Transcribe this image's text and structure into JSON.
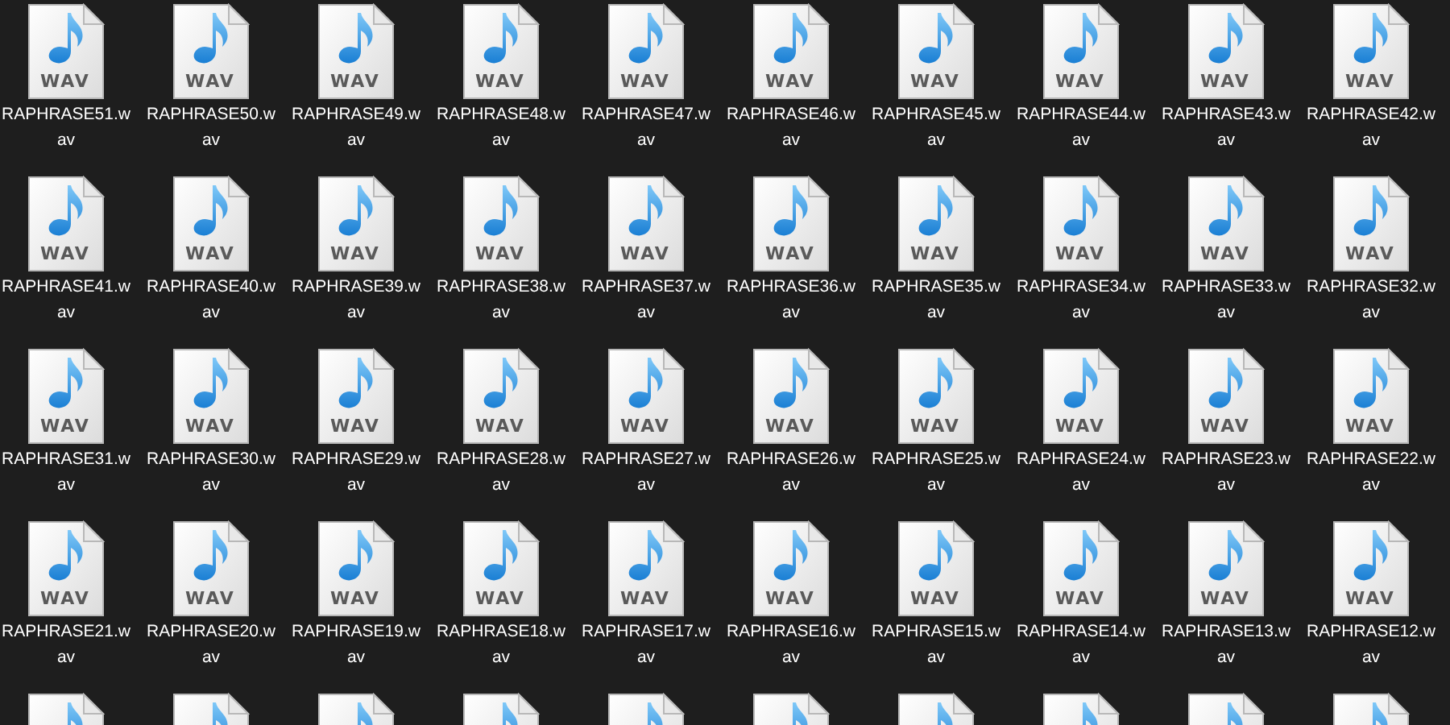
{
  "rows": [
    {
      "files": [
        {
          "kind": "full",
          "type": "WAV",
          "name": "RAPHRASE51.wav"
        },
        {
          "kind": "full",
          "type": "WAV",
          "name": "RAPHRASE50.wav"
        },
        {
          "kind": "full",
          "type": "WAV",
          "name": "RAPHRASE49.wav"
        },
        {
          "kind": "full",
          "type": "WAV",
          "name": "RAPHRASE48.wav"
        },
        {
          "kind": "full",
          "type": "WAV",
          "name": "RAPHRASE47.wav"
        },
        {
          "kind": "full",
          "type": "WAV",
          "name": "RAPHRASE46.wav"
        },
        {
          "kind": "full",
          "type": "WAV",
          "name": "RAPHRASE45.wav"
        },
        {
          "kind": "full",
          "type": "WAV",
          "name": "RAPHRASE44.wav"
        },
        {
          "kind": "full",
          "type": "WAV",
          "name": "RAPHRASE43.wav"
        },
        {
          "kind": "full",
          "type": "WAV",
          "name": "RAPHRASE42.wav"
        }
      ]
    },
    {
      "files": [
        {
          "kind": "full",
          "type": "WAV",
          "name": "RAPHRASE41.wav"
        },
        {
          "kind": "full",
          "type": "WAV",
          "name": "RAPHRASE40.wav"
        },
        {
          "kind": "full",
          "type": "WAV",
          "name": "RAPHRASE39.wav"
        },
        {
          "kind": "full",
          "type": "WAV",
          "name": "RAPHRASE38.wav"
        },
        {
          "kind": "full",
          "type": "WAV",
          "name": "RAPHRASE37.wav"
        },
        {
          "kind": "full",
          "type": "WAV",
          "name": "RAPHRASE36.wav"
        },
        {
          "kind": "full",
          "type": "WAV",
          "name": "RAPHRASE35.wav"
        },
        {
          "kind": "full",
          "type": "WAV",
          "name": "RAPHRASE34.wav"
        },
        {
          "kind": "full",
          "type": "WAV",
          "name": "RAPHRASE33.wav"
        },
        {
          "kind": "full",
          "type": "WAV",
          "name": "RAPHRASE32.wav"
        }
      ]
    },
    {
      "files": [
        {
          "kind": "full",
          "type": "WAV",
          "name": "RAPHRASE31.wav"
        },
        {
          "kind": "full",
          "type": "WAV",
          "name": "RAPHRASE30.wav"
        },
        {
          "kind": "full",
          "type": "WAV",
          "name": "RAPHRASE29.wav"
        },
        {
          "kind": "full",
          "type": "WAV",
          "name": "RAPHRASE28.wav"
        },
        {
          "kind": "full",
          "type": "WAV",
          "name": "RAPHRASE27.wav"
        },
        {
          "kind": "full",
          "type": "WAV",
          "name": "RAPHRASE26.wav"
        },
        {
          "kind": "full",
          "type": "WAV",
          "name": "RAPHRASE25.wav"
        },
        {
          "kind": "full",
          "type": "WAV",
          "name": "RAPHRASE24.wav"
        },
        {
          "kind": "full",
          "type": "WAV",
          "name": "RAPHRASE23.wav"
        },
        {
          "kind": "full",
          "type": "WAV",
          "name": "RAPHRASE22.wav"
        }
      ]
    },
    {
      "files": [
        {
          "kind": "full",
          "type": "WAV",
          "name": "RAPHRASE21.wav"
        },
        {
          "kind": "full",
          "type": "WAV",
          "name": "RAPHRASE20.wav"
        },
        {
          "kind": "full",
          "type": "WAV",
          "name": "RAPHRASE19.wav"
        },
        {
          "kind": "full",
          "type": "WAV",
          "name": "RAPHRASE18.wav"
        },
        {
          "kind": "full",
          "type": "WAV",
          "name": "RAPHRASE17.wav"
        },
        {
          "kind": "full",
          "type": "WAV",
          "name": "RAPHRASE16.wav"
        },
        {
          "kind": "full",
          "type": "WAV",
          "name": "RAPHRASE15.wav"
        },
        {
          "kind": "full",
          "type": "WAV",
          "name": "RAPHRASE14.wav"
        },
        {
          "kind": "full",
          "type": "WAV",
          "name": "RAPHRASE13.wav"
        },
        {
          "kind": "full",
          "type": "WAV",
          "name": "RAPHRASE12.wav"
        }
      ]
    },
    {
      "files": [
        {
          "kind": "partial"
        },
        {
          "kind": "partial"
        },
        {
          "kind": "partial"
        },
        {
          "kind": "partial"
        },
        {
          "kind": "partial"
        },
        {
          "kind": "partial"
        },
        {
          "kind": "partial"
        },
        {
          "kind": "partial"
        },
        {
          "kind": "partial"
        },
        {
          "kind": "partial"
        }
      ]
    }
  ]
}
